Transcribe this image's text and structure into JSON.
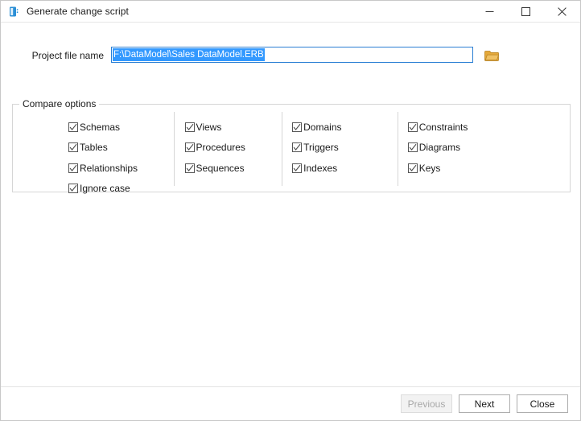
{
  "window": {
    "title": "Generate change script",
    "icon": "app-database-icon",
    "controls": {
      "minimize": "minimize-icon",
      "maximize": "maximize-icon",
      "close": "close-icon"
    }
  },
  "form": {
    "project_file": {
      "label": "Project file name",
      "value": "F:\\DataModel\\Sales DataModel.ERB",
      "placeholder": "",
      "selected": true,
      "browse_icon": "folder-open-icon"
    }
  },
  "compare_options": {
    "title": "Compare options",
    "columns": [
      {
        "items": [
          {
            "label": "Schemas",
            "checked": true
          },
          {
            "label": "Tables",
            "checked": true
          },
          {
            "label": "Relationships",
            "checked": true
          },
          {
            "label": "Ignore case",
            "checked": true
          }
        ]
      },
      {
        "items": [
          {
            "label": "Views",
            "checked": true
          },
          {
            "label": "Procedures",
            "checked": true
          },
          {
            "label": "Sequences",
            "checked": true
          }
        ]
      },
      {
        "items": [
          {
            "label": "Domains",
            "checked": true
          },
          {
            "label": "Triggers",
            "checked": true
          },
          {
            "label": "Indexes",
            "checked": true
          }
        ]
      },
      {
        "items": [
          {
            "label": "Constraints",
            "checked": true
          },
          {
            "label": "Diagrams",
            "checked": true
          },
          {
            "label": "Keys",
            "checked": true
          }
        ]
      }
    ]
  },
  "footer": {
    "previous_label": "Previous",
    "previous_disabled": true,
    "next_label": "Next",
    "close_label": "Close"
  },
  "colors": {
    "accent": "#3399ff",
    "focus_border": "#2a7fd4",
    "folder": "#e5a93b",
    "close_hover": "#e81123"
  }
}
